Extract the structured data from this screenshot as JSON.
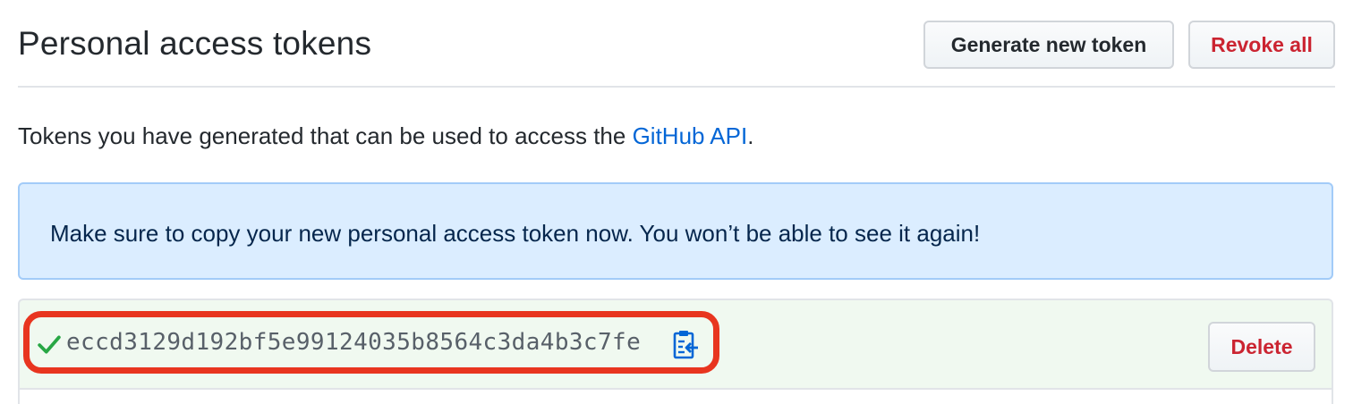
{
  "header": {
    "title": "Personal access tokens",
    "generate_label": "Generate new token",
    "revoke_label": "Revoke all"
  },
  "description": {
    "prefix": "Tokens you have generated that can be used to access the ",
    "link_text": "GitHub API",
    "suffix": "."
  },
  "flash": {
    "message": "Make sure to copy your new personal access token now. You won’t be able to see it again!"
  },
  "token": {
    "value": "eccd3129d192bf5e99124035b8564c3da4b3c7fe",
    "delete_label": "Delete",
    "status_icon": "check-icon",
    "copy_icon": "clipboard-icon"
  },
  "colors": {
    "link": "#0366d6",
    "danger": "#cb2431",
    "success": "#28a745",
    "flash_bg": "#dbedff",
    "token_bg": "#f0f9f0",
    "highlight": "#e8351f"
  }
}
